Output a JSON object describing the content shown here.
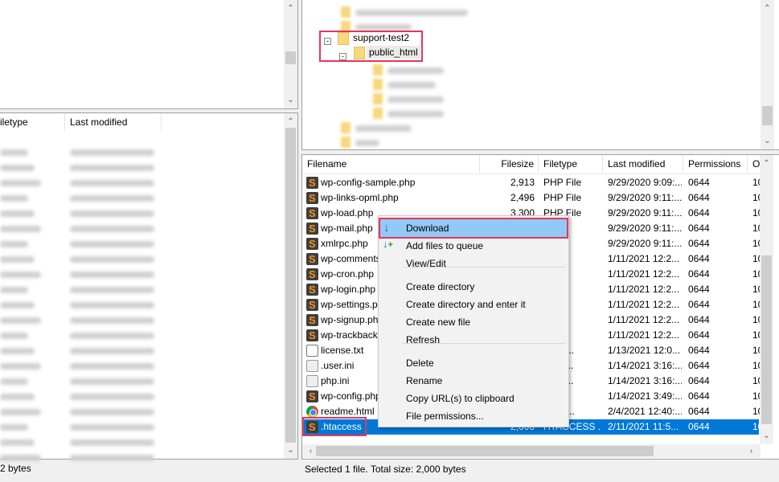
{
  "left_pane": {
    "header": {
      "filetype": "iletype",
      "last_modified": "Last modified"
    },
    "status": "2 bytes"
  },
  "remote_tree": {
    "items": [
      {
        "label": "support-test2"
      },
      {
        "label": "public_html"
      }
    ]
  },
  "file_list": {
    "columns": [
      "Filename",
      "Filesize",
      "Filetype",
      "Last modified",
      "Permissions",
      "O"
    ],
    "rows": [
      {
        "name": "wp-config-sample.php",
        "size": "2,913",
        "type": "PHP File",
        "modified": "9/29/2020 9:09:...",
        "perm": "0644",
        "owner": "10",
        "icon": "php"
      },
      {
        "name": "wp-links-opml.php",
        "size": "2,496",
        "type": "PHP File",
        "modified": "9/29/2020 9:11:...",
        "perm": "0644",
        "owner": "10",
        "icon": "php"
      },
      {
        "name": "wp-load.php",
        "size": "3,300",
        "type": "PHP File",
        "modified": "9/29/2020 9:11:...",
        "perm": "0644",
        "owner": "10",
        "icon": "php"
      },
      {
        "name": "wp-mail.php",
        "size": "",
        "type": "File",
        "modified": "9/29/2020 9:11:...",
        "perm": "0644",
        "owner": "10",
        "icon": "php"
      },
      {
        "name": "xmlrpc.php",
        "size": "",
        "type": "File",
        "modified": "9/29/2020 9:11:...",
        "perm": "0644",
        "owner": "10",
        "icon": "php"
      },
      {
        "name": "wp-comments-post.php",
        "size": "",
        "type": "File",
        "modified": "1/11/2021 12:2...",
        "perm": "0644",
        "owner": "10",
        "icon": "php"
      },
      {
        "name": "wp-cron.php",
        "size": "",
        "type": "File",
        "modified": "1/11/2021 12:2...",
        "perm": "0644",
        "owner": "10",
        "icon": "php"
      },
      {
        "name": "wp-login.php",
        "size": "",
        "type": "File",
        "modified": "1/11/2021 12:2...",
        "perm": "0644",
        "owner": "10",
        "icon": "php"
      },
      {
        "name": "wp-settings.php",
        "size": "",
        "type": "File",
        "modified": "1/11/2021 12:2...",
        "perm": "0644",
        "owner": "10",
        "icon": "php"
      },
      {
        "name": "wp-signup.php",
        "size": "",
        "type": "File",
        "modified": "1/11/2021 12:2...",
        "perm": "0644",
        "owner": "10",
        "icon": "php"
      },
      {
        "name": "wp-trackback.php",
        "size": "",
        "type": "File",
        "modified": "1/11/2021 12:2...",
        "perm": "0644",
        "owner": "10",
        "icon": "php"
      },
      {
        "name": "license.txt",
        "size": "",
        "type": "Docu...",
        "modified": "1/13/2021 12:0...",
        "perm": "0644",
        "owner": "10",
        "icon": "txt"
      },
      {
        "name": ".user.ini",
        "size": "",
        "type": "gurat...",
        "modified": "1/14/2021 3:16:...",
        "perm": "0644",
        "owner": "10",
        "icon": "ini"
      },
      {
        "name": "php.ini",
        "size": "",
        "type": "gurat...",
        "modified": "1/14/2021 3:16:...",
        "perm": "0644",
        "owner": "10",
        "icon": "ini"
      },
      {
        "name": "wp-config.php",
        "size": "",
        "type": "File",
        "modified": "1/14/2021 3:49:...",
        "perm": "0644",
        "owner": "10",
        "icon": "php"
      },
      {
        "name": "readme.html",
        "size": "",
        "type": "me H...",
        "modified": "2/4/2021 12:40:...",
        "perm": "0644",
        "owner": "10",
        "icon": "html"
      },
      {
        "name": ".htaccess",
        "size": "2,000",
        "type": "HTACCESS ...",
        "modified": "2/11/2021 11:5...",
        "perm": "0644",
        "owner": "10",
        "icon": "php",
        "selected": true
      }
    ],
    "status": "Selected 1 file. Total size: 2,000 bytes"
  },
  "context_menu": {
    "items": [
      "Download",
      "Add files to queue",
      "View/Edit",
      "Create directory",
      "Create directory and enter it",
      "Create new file",
      "Refresh",
      "Delete",
      "Rename",
      "Copy URL(s) to clipboard",
      "File permissions..."
    ]
  },
  "colors": {
    "selection": "#0078d7",
    "highlight": "#91c9f7",
    "annotation": "#e8345a"
  }
}
